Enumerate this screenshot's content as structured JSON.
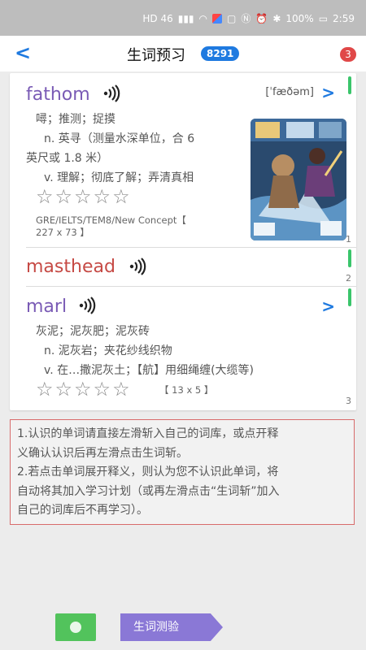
{
  "status_bar": {
    "signal_text": "HD 46",
    "battery": "100%",
    "time": "2:59",
    "icons": [
      "hd-icon",
      "signal-icon",
      "wifi-icon",
      "app-badge-icon",
      "chat-icon",
      "nfc-icon",
      "alarm-icon",
      "bluetooth-icon",
      "battery-icon"
    ]
  },
  "header": {
    "title": "生词预习",
    "count": "8291",
    "badge": "3",
    "back_icon": "chevron-left-icon"
  },
  "words": [
    {
      "word": "fathom",
      "phonetic": "[ˈfæðəm]",
      "definitions": [
        "噚；推测；捉摸",
        "n.  英寻（测量水深单位，合 6",
        "英尺或 1.8 米）",
        "v.  理解；彻底了解；弄清真相"
      ],
      "stars": "☆☆☆☆☆",
      "tags_line1": "GRE/IELTS/TEM8/New Concept【",
      "tags_line2": "227 x 73 】",
      "index": "1"
    },
    {
      "word": "masthead",
      "index": "2"
    },
    {
      "word": "marl",
      "definitions": [
        "灰泥；泥灰肥；泥灰砖",
        "n.  泥灰岩；夹花纱线织物",
        "v.  在…撒泥灰土；【航】用细绳缠(大缆等)"
      ],
      "stars": "☆☆☆☆☆",
      "tags": "【 13 x 5 】",
      "index": "3"
    }
  ],
  "notes": [
    "1.认识的单词请直接左滑斩入自己的词库，或点开释",
    "义确认认识后再左滑点击生词斩。",
    "2.若点击单词展开释义，则认为您不认识此单词，将",
    "自动将其加入学习计划（或再左滑点击“生词斩”加入",
    "自己的词库后不再学习）。"
  ],
  "bottom": {
    "quiz_label": "生词测验"
  },
  "colors": {
    "accent": "#1f7ae0",
    "word_purple": "#7a5bb5",
    "word_red": "#c64a45",
    "green": "#3ac56b",
    "note_border": "#d86b6b",
    "quiz": "#8a78d6"
  }
}
